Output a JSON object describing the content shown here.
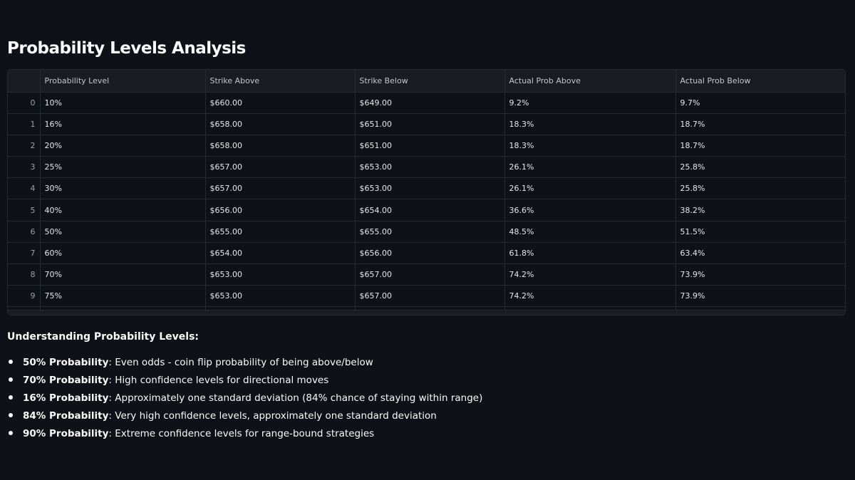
{
  "page": {
    "title": "Probability Levels Analysis"
  },
  "table": {
    "columns": [
      "",
      "Probability Level",
      "Strike Above",
      "Strike Below",
      "Actual Prob Above",
      "Actual Prob Below"
    ],
    "rows": [
      [
        "0",
        "10%",
        "$660.00",
        "$649.00",
        "9.2%",
        "9.7%"
      ],
      [
        "1",
        "16%",
        "$658.00",
        "$651.00",
        "18.3%",
        "18.7%"
      ],
      [
        "2",
        "20%",
        "$658.00",
        "$651.00",
        "18.3%",
        "18.7%"
      ],
      [
        "3",
        "25%",
        "$657.00",
        "$653.00",
        "26.1%",
        "25.8%"
      ],
      [
        "4",
        "30%",
        "$657.00",
        "$653.00",
        "26.1%",
        "25.8%"
      ],
      [
        "5",
        "40%",
        "$656.00",
        "$654.00",
        "36.6%",
        "38.2%"
      ],
      [
        "6",
        "50%",
        "$655.00",
        "$655.00",
        "48.5%",
        "51.5%"
      ],
      [
        "7",
        "60%",
        "$654.00",
        "$656.00",
        "61.8%",
        "63.4%"
      ],
      [
        "8",
        "70%",
        "$653.00",
        "$657.00",
        "74.2%",
        "73.9%"
      ],
      [
        "9",
        "75%",
        "$653.00",
        "$657.00",
        "74.2%",
        "73.9%"
      ]
    ]
  },
  "explanation": {
    "title": "Understanding Probability Levels:",
    "items": [
      {
        "bold": "50% Probability",
        "text": ": Even odds - coin flip probability of being above/below"
      },
      {
        "bold": "70% Probability",
        "text": ": High confidence levels for directional moves"
      },
      {
        "bold": "16% Probability",
        "text": ": Approximately one standard deviation (84% chance of staying within range)"
      },
      {
        "bold": "84% Probability",
        "text": ": Very high confidence levels, approximately one standard deviation"
      },
      {
        "bold": "90% Probability",
        "text": ": Extreme confidence levels for range-bound strategies"
      }
    ]
  }
}
